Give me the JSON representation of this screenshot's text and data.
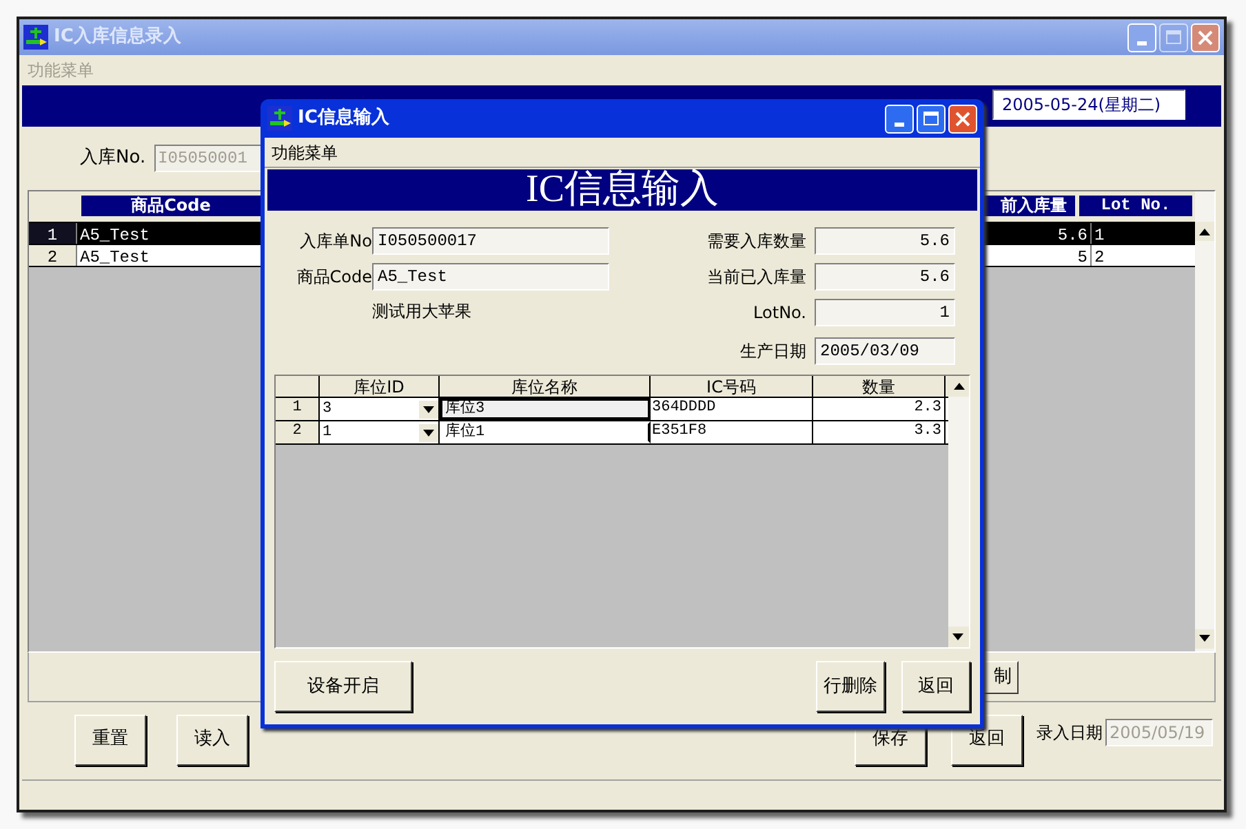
{
  "main_window": {
    "title": "IC入库信息录入",
    "menu": [
      "功能菜单"
    ],
    "date": "2005-05-24(星期二)",
    "receipt_no": {
      "label": "入库No.",
      "value": "I05050001",
      "disabled": true
    },
    "grid": {
      "columns": [
        "商品Code",
        "前入库量",
        "Lot No."
      ],
      "rows": [
        {
          "number": "1",
          "cells": [
            "A5_Test",
            "5.6",
            "1"
          ],
          "selected": true
        },
        {
          "number": "2",
          "cells": [
            "A5_Test",
            "5",
            "2"
          ],
          "selected": false
        }
      ]
    },
    "partial_button": "制",
    "buttons": [
      "重置",
      "读入",
      "保存",
      "返回"
    ],
    "entry_date": {
      "label": "录入日期",
      "value": "2005/05/19",
      "disabled": true
    }
  },
  "dialog": {
    "title": "IC信息输入",
    "menu": [
      "功能菜单"
    ],
    "banner_title": "IC信息输入",
    "left_fields": [
      {
        "label": "入库单No",
        "value": "I050500017"
      },
      {
        "label": "商品Code",
        "value": "A5_Test"
      }
    ],
    "description": "测试用大苹果",
    "right_fields": [
      {
        "label": "需要入库数量",
        "value": "5.6"
      },
      {
        "label": "当前已入库量",
        "value": "5.6"
      },
      {
        "label": "LotNo.",
        "value": "1"
      },
      {
        "label": "生产日期",
        "value": "2005/03/09"
      }
    ],
    "grid": {
      "columns": [
        "库位ID",
        "库位名称",
        "IC号码",
        "数量"
      ],
      "rows": [
        {
          "number": "1",
          "location_id": "3",
          "location_name": "库位3",
          "ic_code": "364DDDD",
          "quantity": "2.3",
          "focused": true
        },
        {
          "number": "2",
          "location_id": "1",
          "location_name": "库位1",
          "ic_code": "E351F8",
          "quantity": "3.3",
          "focused": false
        }
      ]
    },
    "left_buttons": [
      "设备开启"
    ],
    "right_buttons": [
      "行删除",
      "返回"
    ]
  }
}
